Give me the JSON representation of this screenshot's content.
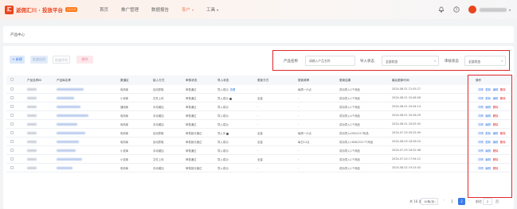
{
  "brand": {
    "logo_mark": "汇",
    "name": "返佣汇川 · 投放平台",
    "badge": "v1.0.0"
  },
  "nav": [
    {
      "label": "首页",
      "active": false
    },
    {
      "label": "推广管理",
      "active": false
    },
    {
      "label": "数据报告",
      "active": false
    },
    {
      "label": "客户",
      "active": true,
      "caret": "▾"
    },
    {
      "label": "工具",
      "active": false,
      "caret": "▾"
    }
  ],
  "header_tools": [
    "bell-icon",
    "help-icon",
    "avatar"
  ],
  "breadcrumb": {
    "title": "产品中心"
  },
  "toolbar": {
    "add_label": "+ 新建",
    "enable_label": "批量启用",
    "disable_label": "批量停用",
    "delete_label": "删除"
  },
  "filters": {
    "product_name_label": "产品名称",
    "product_name_placeholder": "请输入产品名称",
    "import_status_label": "导入状态",
    "import_status_value": "全部状态",
    "review_status_label": "审核状态",
    "review_status_value": "全部状态"
  },
  "table": {
    "columns": [
      "产品名称ID",
      "产品库名称",
      "渠道区",
      "接入方式",
      "审核状态",
      "导入状态",
      "更新方式",
      "更新频率",
      "更新结果",
      "最后更新时间",
      "操作"
    ],
    "rows": [
      {
        "channel": "电商库",
        "access": "自动抓取",
        "review": "审核通过",
        "import": "导入成功",
        "import_link": "查看",
        "update_mode": "-",
        "freq": "每周一/5点",
        "result": "成功导入2个商品",
        "time": "2024-08-01 21:55:27",
        "ops": [
          "详情",
          "更新",
          "编辑",
          "删除"
        ]
      },
      {
        "channel": "小说库",
        "access": "文件上传",
        "review": "审核通过",
        "import": "导入成功",
        "import_icon": true,
        "update_mode": "全量",
        "freq": "-",
        "result": "成功导入1个商品",
        "time": "2024-08-01 20:48:56",
        "ops": [
          "详情",
          "更新",
          "编辑",
          "删除"
        ]
      },
      {
        "channel": "通用库",
        "access": "手动增加",
        "review": "审核通过",
        "import": "导入成功",
        "update_mode": "-",
        "freq": "-",
        "result": "成功导入1个商品",
        "time": "2024-08-01 20:44:14",
        "ops": [
          "详情",
          "编辑",
          "删除"
        ]
      },
      {
        "channel": "电商库",
        "access": "手动增加",
        "review": "审核通过",
        "import": "导入成功",
        "update_mode": "-",
        "freq": "-",
        "result": "成功导入4个商品",
        "time": "2024-08-01 20:28:29",
        "ops": [
          "详情",
          "编辑",
          "删除"
        ]
      },
      {
        "channel": "电商库",
        "access": "手动增加",
        "review": "审核通过",
        "import": "导入成功",
        "update_mode": "-",
        "freq": "-",
        "result": "成功导入1个商品",
        "time": "2024-08-01 20:05:03",
        "ops": [
          "详情",
          "编辑",
          "删除"
        ]
      },
      {
        "channel": "电商库",
        "access": "自动抓取",
        "review": "审核部分通过",
        "import": "导入中",
        "import_icon": true,
        "update_mode": "全量",
        "freq": "每周一/5点",
        "result": "成功导入490/2017商品",
        "time": "2024-07-29 05:25:09",
        "ops": [
          "详情",
          "更新",
          "编辑",
          "删除"
        ]
      },
      {
        "channel": "电商库",
        "access": "自动抓取",
        "review": "审核部分通过",
        "import": "导入成功",
        "update_mode": "全量",
        "freq": "每日12点",
        "result": "成功导入1806/2017个商品",
        "time": "2024-08-03 18:26:24",
        "ops": [
          "详情",
          "更新",
          "编辑",
          "删除"
        ]
      },
      {
        "channel": "小说库",
        "access": "手动增加",
        "review": "审核通过",
        "import": "导入成功",
        "update_mode": "-",
        "freq": "-",
        "result": "成功导入1个商品",
        "time": "2024-07-29 16:32:48",
        "ops": [
          "详情",
          "编辑",
          "删除"
        ]
      },
      {
        "channel": "小说库",
        "access": "文件上传",
        "review": "审核通过",
        "import": "导入成功",
        "update_mode": "全量",
        "freq": "-",
        "result": "成功导入1个商品",
        "time": "2024-07-24 17:54:12",
        "ops": [
          "详情",
          "编辑",
          "删除"
        ]
      },
      {
        "channel": "电商库",
        "access": "手动增加",
        "review": "审核部分通过",
        "import": "导入成功",
        "update_mode": "-",
        "freq": "-",
        "result": "成功导入1个商品",
        "time": "2024-08-02 19:15:03",
        "ops": [
          "详情",
          "编辑",
          "删除"
        ]
      }
    ]
  },
  "pagination": {
    "total": "共 16 条",
    "page_size": "10条/页",
    "pages": [
      "1",
      "2"
    ],
    "current": "2",
    "goto_label": "前往",
    "goto_value": "2",
    "goto_unit": "页"
  },
  "colors": {
    "accent": "#3a7be8",
    "brand": "#e8451f",
    "highlight": "#e0282e"
  }
}
